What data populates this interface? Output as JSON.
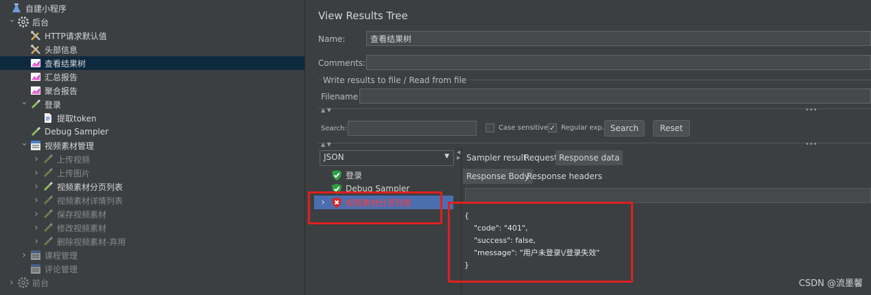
{
  "tree": [
    {
      "label": "自建小程序",
      "indent": 0,
      "arrow": "",
      "icon": "flask-icon",
      "dim": false
    },
    {
      "label": "后台",
      "indent": 1,
      "arrow": "⌄",
      "icon": "gear-icon",
      "dim": false
    },
    {
      "label": "HTTP请求默认值",
      "indent": 2,
      "arrow": "",
      "icon": "wrench-icon",
      "dim": false
    },
    {
      "label": "头部信息",
      "indent": 2,
      "arrow": "",
      "icon": "wrench-icon",
      "dim": false
    },
    {
      "label": "查看结果树",
      "indent": 2,
      "arrow": "",
      "icon": "chart-icon",
      "dim": false,
      "selected": true
    },
    {
      "label": "汇总报告",
      "indent": 2,
      "arrow": "",
      "icon": "chart-icon",
      "dim": false
    },
    {
      "label": "聚合报告",
      "indent": 2,
      "arrow": "",
      "icon": "chart-icon",
      "dim": false
    },
    {
      "label": "登录",
      "indent": 2,
      "arrow": "⌄",
      "icon": "pipette-icon",
      "dim": false
    },
    {
      "label": "提取token",
      "indent": 3,
      "arrow": "",
      "icon": "document-icon",
      "dim": false
    },
    {
      "label": "Debug Sampler",
      "indent": 2,
      "arrow": "",
      "icon": "pipette-icon",
      "dim": false
    },
    {
      "label": "视频素材管理",
      "indent": 2,
      "arrow": "⌄",
      "icon": "controller-icon",
      "dim": false
    },
    {
      "label": "上传视频",
      "indent": 3,
      "arrow": "›",
      "icon": "pipette-icon",
      "dim": true
    },
    {
      "label": "上传图片",
      "indent": 3,
      "arrow": "›",
      "icon": "pipette-icon",
      "dim": true
    },
    {
      "label": "视频素材分页列表",
      "indent": 3,
      "arrow": "›",
      "icon": "pipette-icon",
      "dim": false
    },
    {
      "label": "视频素材详情列表",
      "indent": 3,
      "arrow": "›",
      "icon": "pipette-icon",
      "dim": true
    },
    {
      "label": "保存视频素材",
      "indent": 3,
      "arrow": "›",
      "icon": "pipette-icon",
      "dim": true
    },
    {
      "label": "修改视频素材",
      "indent": 3,
      "arrow": "›",
      "icon": "pipette-icon",
      "dim": true
    },
    {
      "label": "删除视频素材-弃用",
      "indent": 3,
      "arrow": "›",
      "icon": "pipette-icon",
      "dim": true
    },
    {
      "label": "课程管理",
      "indent": 2,
      "arrow": "›",
      "icon": "controller-icon",
      "dim": true
    },
    {
      "label": "评论管理",
      "indent": 2,
      "arrow": "",
      "icon": "controller-icon",
      "dim": true
    },
    {
      "label": "前台",
      "indent": 1,
      "arrow": "›",
      "icon": "gear-icon",
      "dim": true
    }
  ],
  "panel": {
    "title": "View Results Tree",
    "name_label": "Name:",
    "name_value": "查看结果树",
    "comments_label": "Comments:",
    "file_group_label": "Write results to file / Read from file",
    "filename_label": "Filename",
    "search_label": "Search:",
    "case_sensitive": "Case sensitive",
    "regular_exp": "Regular exp.",
    "search_button": "Search",
    "reset_button": "Reset",
    "renderer": "JSON"
  },
  "results": [
    {
      "label": "登录",
      "status": "success"
    },
    {
      "label": "Debug Sampler",
      "status": "success"
    },
    {
      "label": "视频素材分页列表",
      "status": "error"
    }
  ],
  "tabs": [
    "Sampler result",
    "Request",
    "Response data"
  ],
  "subtabs": [
    "Response Body",
    "Response headers"
  ],
  "response_body": "{\n    \"code\": \"401\",\n    \"success\": false,\n    \"message\": \"用户未登录\\/登录失效\"\n}",
  "watermark": "CSDN @流墨馨",
  "colors": {
    "highlight": "#e02020",
    "selected_row": "#0d293e",
    "result_selected": "#4b6eaf"
  }
}
